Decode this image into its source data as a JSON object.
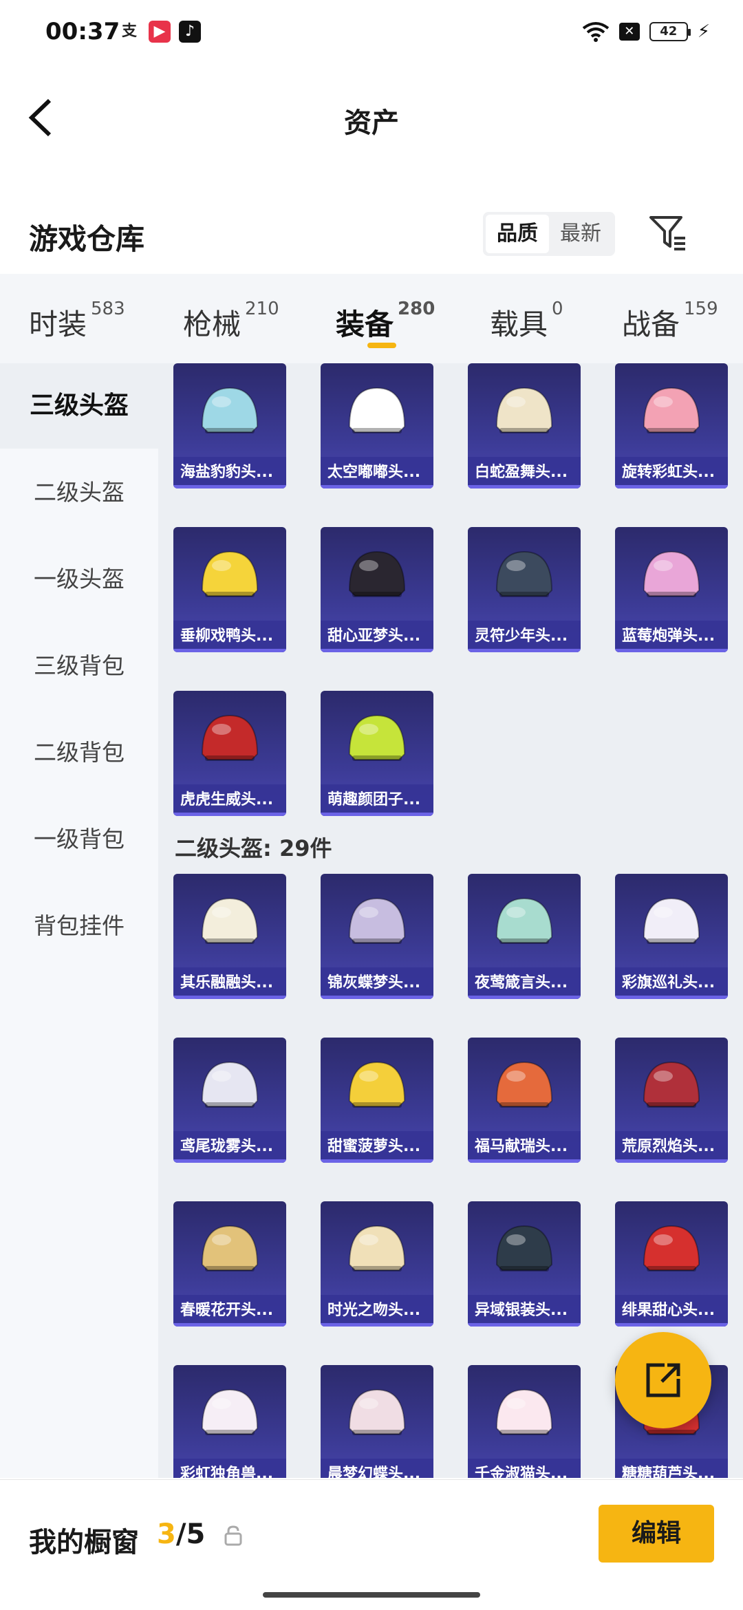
{
  "status": {
    "time": "00:37",
    "battery": "42"
  },
  "header": {
    "title": "资产"
  },
  "section": {
    "title": "游戏仓库",
    "sort_quality": "品质",
    "sort_latest": "最新"
  },
  "tabs": [
    {
      "label": "时装",
      "count": "583"
    },
    {
      "label": "枪械",
      "count": "210"
    },
    {
      "label": "装备",
      "count": "280"
    },
    {
      "label": "载具",
      "count": "0"
    },
    {
      "label": "战备",
      "count": "159"
    }
  ],
  "sidebar": [
    "三级头盔",
    "二级头盔",
    "一级头盔",
    "三级背包",
    "二级背包",
    "一级背包",
    "背包挂件"
  ],
  "level3": [
    "海盐豹豹头...",
    "太空嘟嘟头...",
    "白蛇盈舞头...",
    "旋转彩虹头...",
    "垂柳戏鸭头...",
    "甜心亚梦头...",
    "灵符少年头...",
    "蓝莓炮弹头...",
    "虎虎生威头...",
    "萌趣颜团子..."
  ],
  "level2_title": "二级头盔: 29件",
  "level2": [
    "其乐融融头...",
    "锦灰蝶梦头...",
    "夜莺箴言头...",
    "彩旗巡礼头...",
    "鸢尾珑雾头...",
    "甜蜜菠萝头...",
    "福马献瑞头...",
    "荒原烈焰头...",
    "春暖花开头...",
    "时光之吻头...",
    "异域银装头...",
    "绯果甜心头...",
    "彩虹独角兽...",
    "晨梦幻蝶头...",
    "千金淑猫头...",
    "糖糖葫芦头..."
  ],
  "colors": {
    "accent": "#f6b512",
    "card_bg": "#3b3a94",
    "helmets3": [
      "#9ed8e6",
      "#ffffff",
      "#efe4c8",
      "#f3a2b4",
      "#f5d43a",
      "#2a2630",
      "#3c4a5e",
      "#e9a6d8",
      "#c42a2a",
      "#c6e43a"
    ],
    "helmets2": [
      "#f3eedc",
      "#c7bde0",
      "#a8dccf",
      "#f1eef8",
      "#e6e6f2",
      "#f4cf3a",
      "#e56a3c",
      "#b0303a",
      "#e2c27a",
      "#f0e0b8",
      "#2e3c4a",
      "#d6302e",
      "#f6eef6",
      "#f0dde4",
      "#fbe8ef",
      "#d43030"
    ]
  },
  "bottom": {
    "label": "我的橱窗",
    "current": "3",
    "total": "/5",
    "edit": "编辑"
  }
}
